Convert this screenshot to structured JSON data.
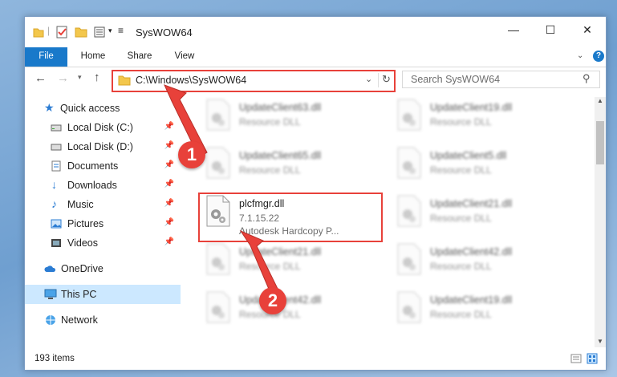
{
  "window": {
    "title": "SysWOW64"
  },
  "ribbon": {
    "tabs": [
      "File",
      "Home",
      "Share",
      "View"
    ]
  },
  "navigation": {
    "address_path": "C:\\Windows\\SysWOW64",
    "search_placeholder": "Search SysWOW64"
  },
  "sidebar": {
    "items": [
      {
        "label": "Quick access",
        "icon": "star-icon"
      },
      {
        "label": "Local Disk (C:)",
        "icon": "drive-icon",
        "pinned": true
      },
      {
        "label": "Local Disk (D:)",
        "icon": "drive-icon",
        "pinned": true
      },
      {
        "label": "Documents",
        "icon": "document-icon",
        "pinned": true
      },
      {
        "label": "Downloads",
        "icon": "download-icon",
        "pinned": true
      },
      {
        "label": "Music",
        "icon": "music-icon",
        "pinned": true
      },
      {
        "label": "Pictures",
        "icon": "picture-icon",
        "pinned": true
      },
      {
        "label": "Videos",
        "icon": "video-icon",
        "pinned": true
      },
      {
        "label": "OneDrive",
        "icon": "cloud-icon"
      },
      {
        "label": "This PC",
        "icon": "computer-icon",
        "selected": true
      },
      {
        "label": "Network",
        "icon": "network-icon"
      }
    ]
  },
  "files": [
    {
      "name": "UpdateClient63.dll",
      "desc": "Resource DLL"
    },
    {
      "name": "UpdateClient19.dll",
      "desc": "Resource DLL"
    },
    {
      "name": "UpdateClient65.dll",
      "desc": "Resource DLL"
    },
    {
      "name": "UpdateClient5.dll",
      "desc": "Resource DLL"
    },
    {
      "name": "plcfmgr.dll",
      "version": "7.1.15.22",
      "desc": "Autodesk Hardcopy P..."
    },
    {
      "name": "UpdateClient21.dll",
      "desc": "Resource DLL"
    },
    {
      "name": "UpdateClient21.dll",
      "desc": "Resource DLL"
    },
    {
      "name": "UpdateClient42.dll",
      "desc": "Resource DLL"
    },
    {
      "name": "UpdateClient42.dll",
      "desc": "Resource DLL"
    },
    {
      "name": "UpdateClient19.dll",
      "desc": "Resource DLL"
    }
  ],
  "status": {
    "item_count": "193 items"
  },
  "annotations": [
    "1",
    "2"
  ],
  "colors": {
    "accent": "#1979ca",
    "highlight": "#e8413a",
    "selected": "#cce8ff"
  }
}
